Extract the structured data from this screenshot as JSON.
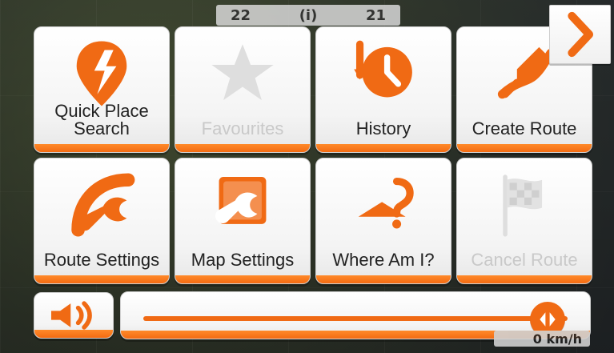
{
  "map": {
    "top_info_left": "22",
    "top_info_mid": "(i)",
    "top_info_right": "21",
    "speed_text": "0 km/h"
  },
  "menu": {
    "tiles": [
      {
        "label": "Quick Place Search",
        "icon": "quick-place-search-icon",
        "enabled": true
      },
      {
        "label": "Favourites",
        "icon": "star-icon",
        "enabled": false
      },
      {
        "label": "History",
        "icon": "history-icon",
        "enabled": true
      },
      {
        "label": "Create Route",
        "icon": "create-route-icon",
        "enabled": true
      },
      {
        "label": "Route Settings",
        "icon": "route-settings-icon",
        "enabled": true
      },
      {
        "label": "Map Settings",
        "icon": "map-settings-icon",
        "enabled": true
      },
      {
        "label": "Where Am I?",
        "icon": "where-am-i-icon",
        "enabled": true
      },
      {
        "label": "Cancel Route",
        "icon": "checkered-flag-icon",
        "enabled": false
      }
    ],
    "next_icon": "chevron-right-icon"
  },
  "volume": {
    "icon": "speaker-icon",
    "level_fraction": 0.95
  },
  "colors": {
    "accent": "#f06a14",
    "disabled_text": "#c9c9c9",
    "tile_bg": "#ffffff"
  }
}
